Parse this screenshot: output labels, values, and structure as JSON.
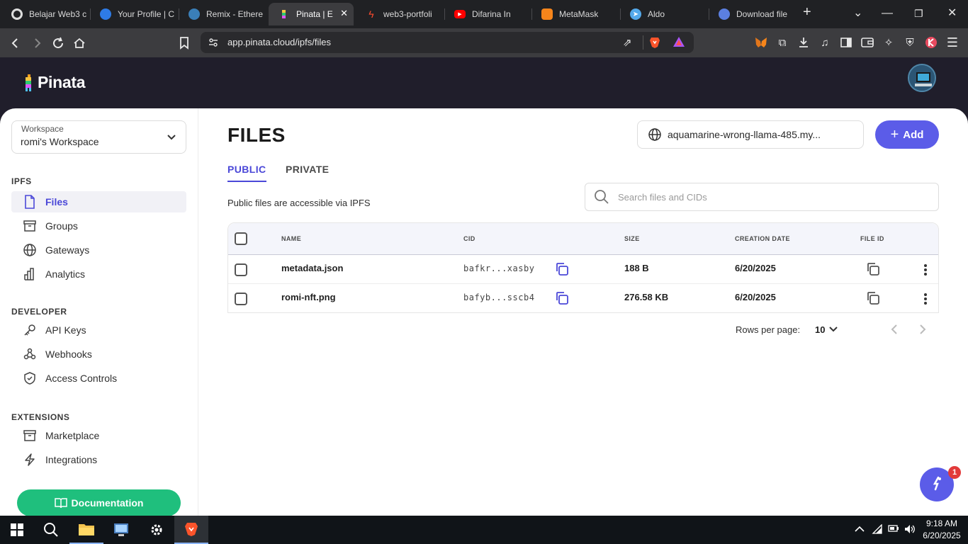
{
  "browser": {
    "tabs": [
      {
        "title": "Belajar Web3 c",
        "favicon": "github-icon"
      },
      {
        "title": "Your Profile | C",
        "favicon": "blue-globe-icon"
      },
      {
        "title": "Remix - Ethere",
        "favicon": "remix-icon"
      },
      {
        "title": "Pinata | Ef",
        "favicon": "pinata-icon",
        "active": true
      },
      {
        "title": "web3-portfoli",
        "favicon": "vercel-icon"
      },
      {
        "title": "Difarina In",
        "favicon": "youtube-icon"
      },
      {
        "title": "MetaMask",
        "favicon": "metamask-icon"
      },
      {
        "title": "Aldo",
        "favicon": "telegram-icon"
      },
      {
        "title": "Download file",
        "favicon": "download-icon"
      }
    ],
    "url": "app.pinata.cloud/ipfs/files"
  },
  "header": {
    "logo_text": "Pinata"
  },
  "sidebar": {
    "workspace_label": "Workspace",
    "workspace_name": "romi's Workspace",
    "sections": [
      {
        "label": "IPFS",
        "items": [
          {
            "label": "Files",
            "icon": "file-icon",
            "active": true
          },
          {
            "label": "Groups",
            "icon": "archive-icon"
          },
          {
            "label": "Gateways",
            "icon": "globe-icon"
          },
          {
            "label": "Analytics",
            "icon": "bar-chart-icon"
          }
        ]
      },
      {
        "label": "DEVELOPER",
        "items": [
          {
            "label": "API Keys",
            "icon": "key-icon"
          },
          {
            "label": "Webhooks",
            "icon": "webhook-icon"
          },
          {
            "label": "Access Controls",
            "icon": "shield-icon"
          }
        ]
      },
      {
        "label": "EXTENSIONS",
        "items": [
          {
            "label": "Marketplace",
            "icon": "store-icon"
          },
          {
            "label": "Integrations",
            "icon": "bolt-icon"
          }
        ]
      }
    ],
    "doc_button": "Documentation"
  },
  "main": {
    "title": "FILES",
    "gateway": "aquamarine-wrong-llama-485.my...",
    "add_button": "Add",
    "tabs": [
      "PUBLIC",
      "PRIVATE"
    ],
    "description": "Public files are accessible via IPFS",
    "search_placeholder": "Search files and CIDs",
    "columns": [
      "NAME",
      "CID",
      "SIZE",
      "CREATION DATE",
      "FILE ID"
    ],
    "rows": [
      {
        "name": "metadata.json",
        "cid": "bafkr...xasby",
        "size": "188 B",
        "date": "6/20/2025"
      },
      {
        "name": "romi-nft.png",
        "cid": "bafyb...sscb4",
        "size": "276.58 KB",
        "date": "6/20/2025"
      }
    ],
    "rows_per_page_label": "Rows per page:",
    "rows_per_page_value": "10"
  },
  "chat": {
    "badge": "1"
  },
  "taskbar": {
    "time": "9:18 AM",
    "date": "6/20/2025"
  },
  "colors": {
    "accent": "#5b5ce8",
    "header_bg": "#201e2b",
    "doc_button": "#1fbf7d"
  }
}
